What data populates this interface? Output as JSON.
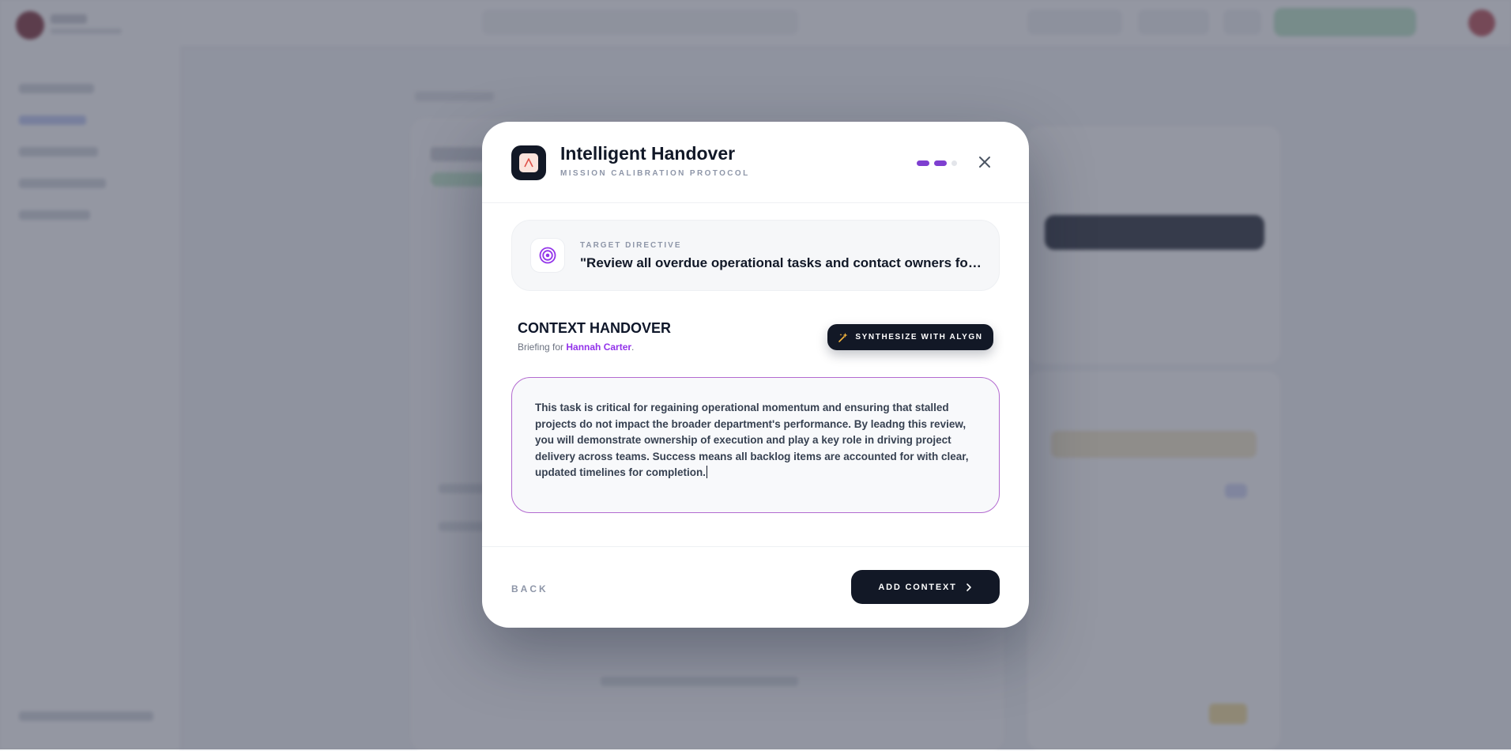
{
  "modal": {
    "title": "Intelligent Handover",
    "subtitle": "MISSION CALIBRATION PROTOCOL",
    "steps": {
      "total": 3,
      "current": 2
    },
    "directive": {
      "label": "TARGET DIRECTIVE",
      "text": "\"Review all overdue operational tasks and contact owners for status updates\""
    },
    "context": {
      "title": "CONTEXT HANDOVER",
      "briefing_prefix": "Briefing for ",
      "recipient": "Hannah Carter",
      "briefing_suffix": ".",
      "synthesize_label": "SYNTHESIZE WITH ALYGN",
      "body": "This task is critical for regaining operational momentum and ensuring that stalled projects do not impact the broader department's performance. By leadng this review, you will demonstrate ownership of execution and play a key role in driving project delivery across teams. Success means all backlog items are accounted for with clear, updated timelines for completion."
    },
    "footer": {
      "back_label": "BACK",
      "add_label": "ADD CONTEXT"
    }
  },
  "colors": {
    "primary_dark": "#121826",
    "accent_purple": "#9333ea",
    "step_active": "#7e3fd0",
    "step_inactive": "#e3e5ea",
    "overlay": "rgba(71,76,94,0.58)"
  },
  "icons": {
    "app": "brand-logo-icon",
    "close": "close-icon",
    "directive": "target-icon",
    "synthesize": "sparkle-icon",
    "add": "chevron-right-icon"
  }
}
